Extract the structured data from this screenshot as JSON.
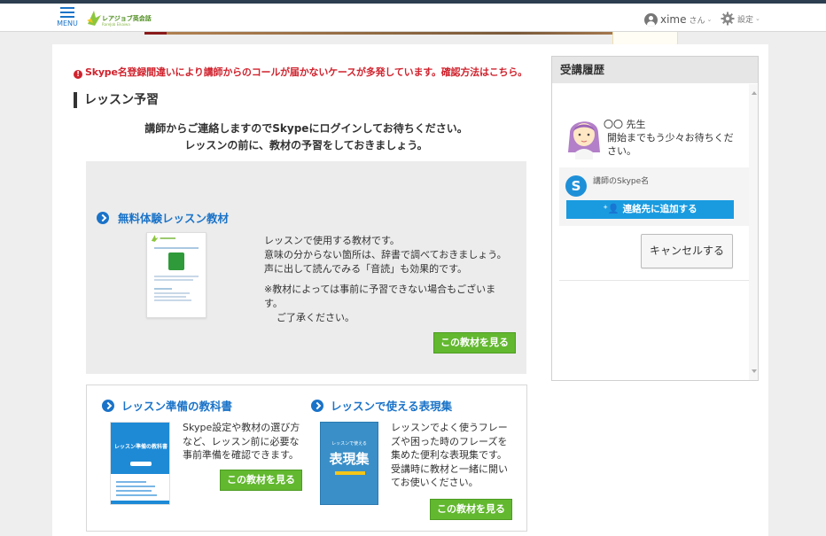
{
  "header": {
    "menu_label": "MENU",
    "logo_text": "レアジョブ英会話",
    "logo_sub": "RareJob Eikaiwa",
    "user_name": "xime",
    "user_suffix": "さん",
    "settings_label": "設定"
  },
  "notice": {
    "text": "Skype名登録間違いにより講師からのコールが届かないケースが多発しています。確認方法はこちら。"
  },
  "section": {
    "title": "レッスン予習",
    "intro_line1": "講師からご連絡しますのでSkypeにログインしてお待ちください。",
    "intro_line2": "レッスンの前に、教材の予習をしておきましょう。"
  },
  "trial": {
    "title": "無料体験レッスン教材",
    "desc": "レッスンで使用する教材です。\n意味の分からない箇所は、辞書で調べておきましょう。\n声に出して読んでみる「音読」も効果的です。",
    "note": "※教材によっては事前に予習できない場合もございます。",
    "note2": "ご了承ください。",
    "button": "この教材を見る"
  },
  "books": [
    {
      "title": "レッスン準備の教科書",
      "cover_text": "レッスン準備の教科書",
      "desc": "Skype設定や教材の選び方など、レッスン前に必要な事前準備を確認できます。",
      "button": "この教材を見る"
    },
    {
      "title": "レッスンで使える表現集",
      "cover_text": "表現集",
      "cover_sub": "レッスンで使える",
      "desc": "レッスンでよく使うフレーズや困った時のフレーズを集めた便利な表現集です。受講時に教材と一緒に開いてお使いください。",
      "button": "この教材を見る"
    }
  ],
  "sidebar": {
    "title": "受講履歴",
    "teacher_name": "〇〇 先生",
    "message": "開始までもう少々お待ちください。",
    "skype_label": "講師のSkype名",
    "add_contact": "連絡先に追加する",
    "cancel": "キャンセルする"
  },
  "colors": {
    "accent_blue": "#1a73c8",
    "green_button": "#62b82f",
    "warning_red": "#d0232e",
    "skype_blue": "#1a9be0"
  }
}
